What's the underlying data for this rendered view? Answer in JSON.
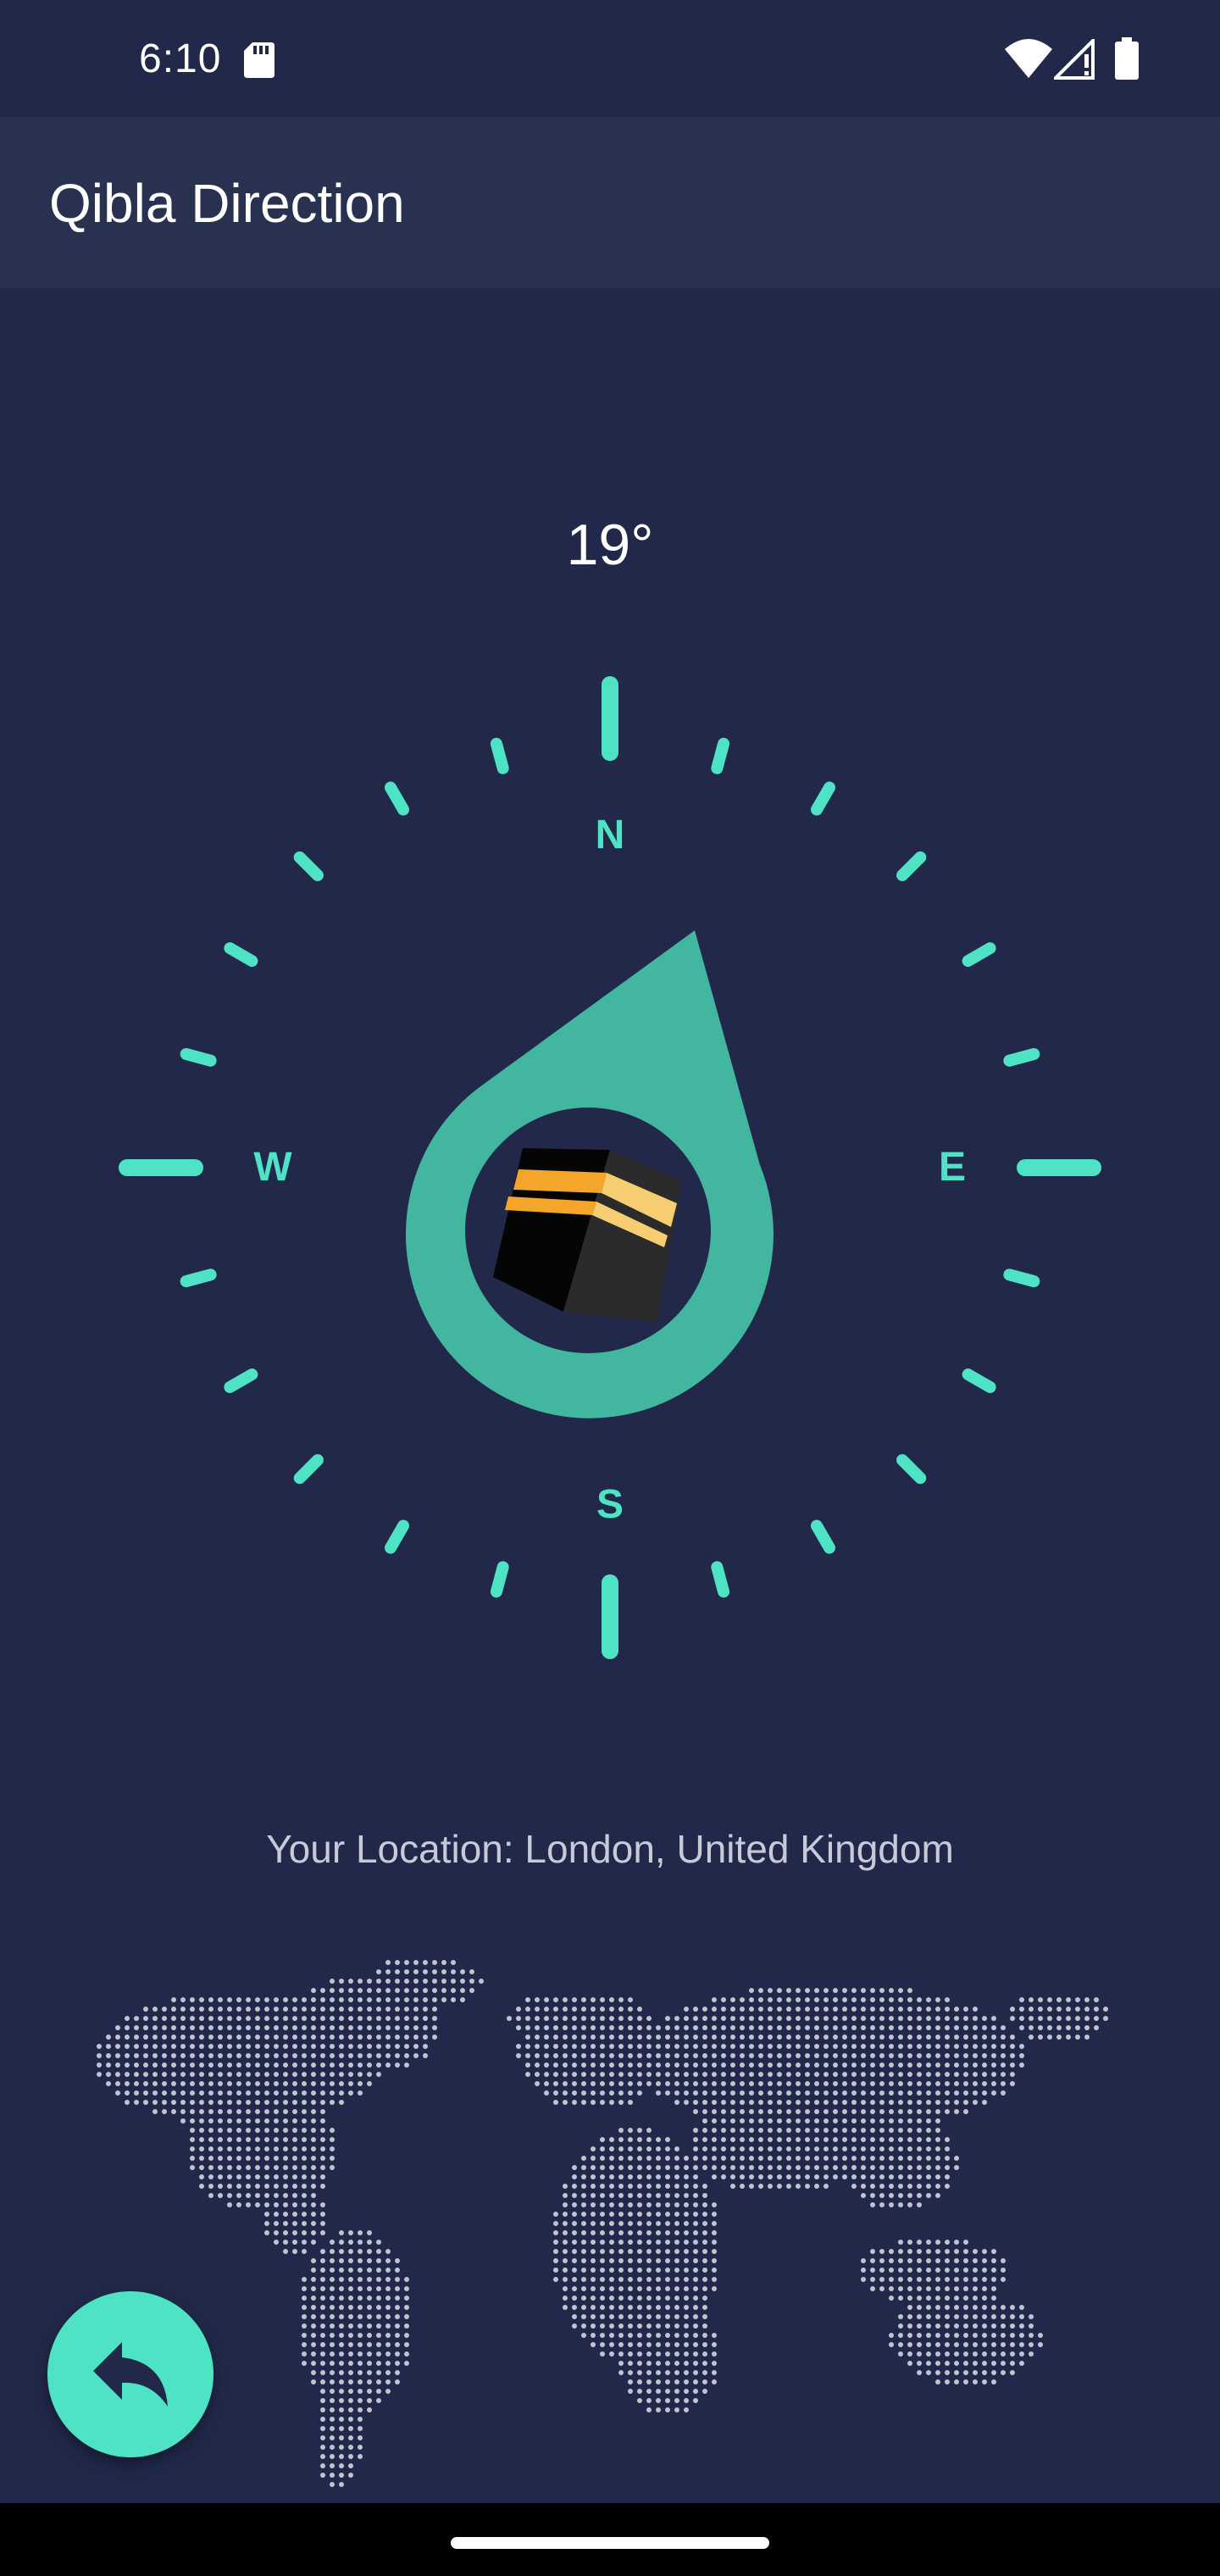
{
  "status_bar": {
    "time": "6:10",
    "icons": [
      "sd-card-icon",
      "wifi-icon",
      "signal-icon",
      "battery-icon"
    ]
  },
  "app_bar": {
    "title": "Qibla Direction"
  },
  "compass": {
    "heading": "19°",
    "qibla_bearing_deg": 19,
    "cardinals": {
      "north": "N",
      "east": "E",
      "south": "S",
      "west": "W"
    },
    "center_icon": "kaaba-icon",
    "accent_color": "#4ee3c4",
    "pointer_color": "#43b6a0"
  },
  "location": {
    "text": "Your Location: London, United Kingdom"
  },
  "fab": {
    "icon": "reply-arrow-icon"
  },
  "colors": {
    "background": "#21284a",
    "app_bar": "#283150",
    "map_dots": "#c0c4d0"
  }
}
